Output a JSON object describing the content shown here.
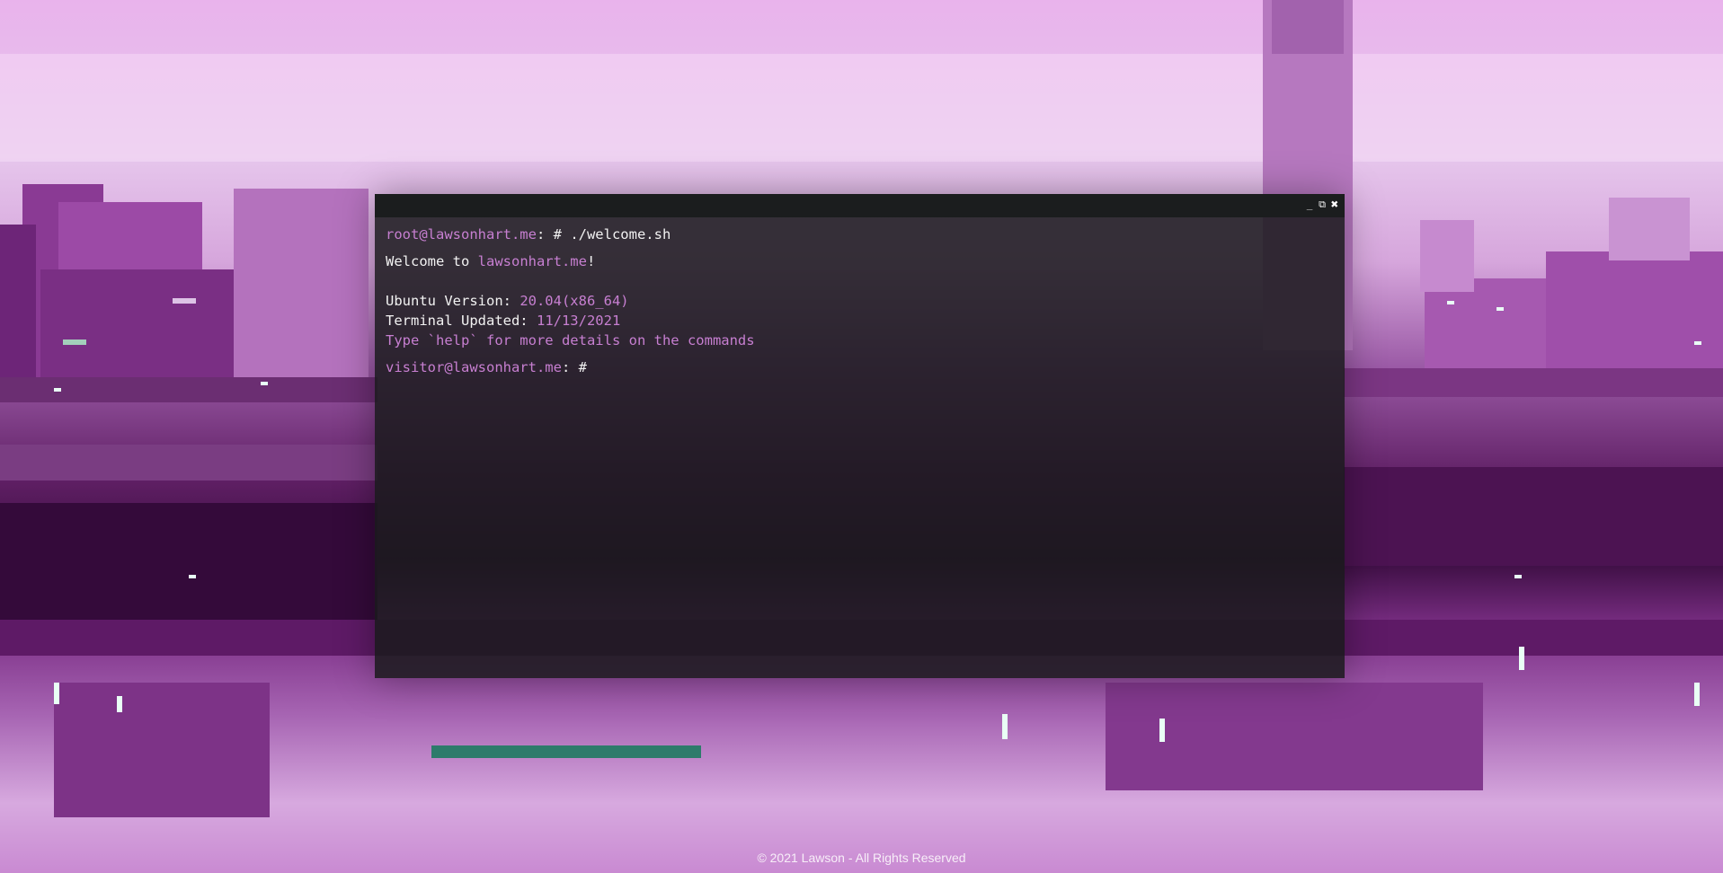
{
  "colors": {
    "accent": "#c77fd1",
    "text": "#f2f2f2",
    "terminal_bg": "#1a1a1c",
    "titlebar_bg": "#1b1d1e"
  },
  "window_controls": {
    "minimize": "_",
    "restore": "⧉",
    "close": "✖"
  },
  "terminal": {
    "command_line": {
      "user_host": "root@lawsonhart.me",
      "separator": ": # ",
      "command": "./welcome.sh"
    },
    "welcome": {
      "prefix": "Welcome to ",
      "site": "lawsonhart.me",
      "suffix": "!"
    },
    "ubuntu": {
      "label": "Ubuntu Version: ",
      "value": "20.04(x86_64)"
    },
    "updated": {
      "label": "Terminal Updated: ",
      "value": "11/13/2021"
    },
    "help_text": "Type `help` for more details on the commands",
    "prompt": {
      "user_host": "visitor@lawsonhart.me",
      "separator": ": #"
    }
  },
  "footer": {
    "text": "© 2021 Lawson - All Rights Reserved"
  }
}
